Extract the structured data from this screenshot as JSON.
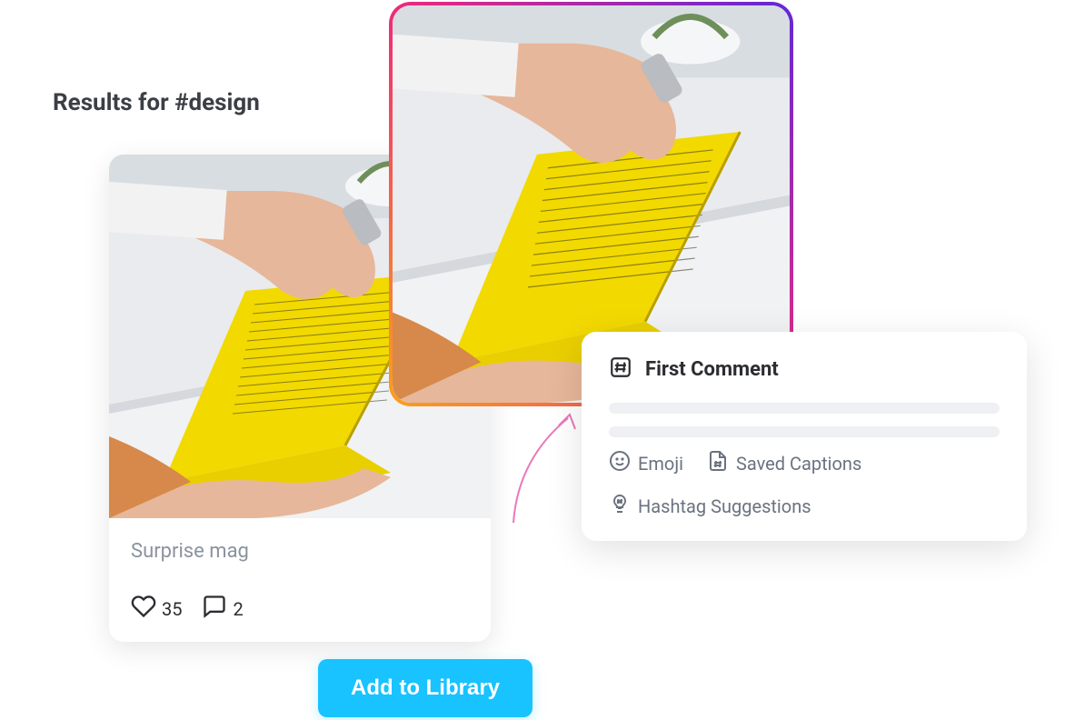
{
  "heading": "Results for #design",
  "post": {
    "caption": "Surprise mag",
    "likes": 35,
    "comments": 2
  },
  "button": {
    "add_to_library": "Add to Library"
  },
  "comment_panel": {
    "title": "First Comment",
    "actions": {
      "emoji": "Emoji",
      "saved_captions": "Saved Captions",
      "hashtag_suggestions": "Hashtag Suggestions"
    }
  }
}
